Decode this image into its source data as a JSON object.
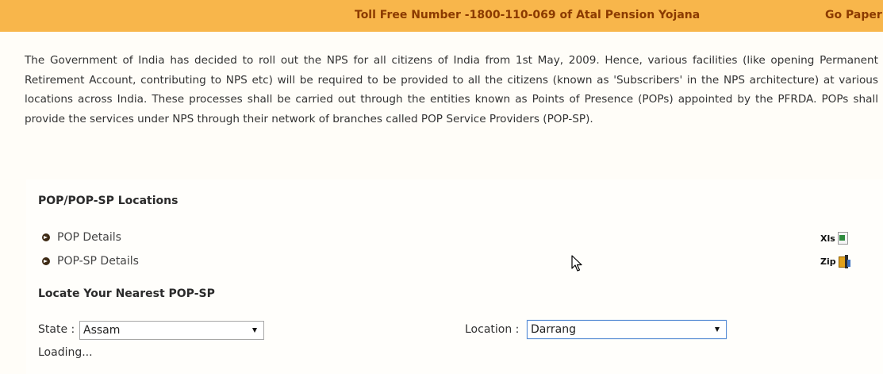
{
  "top_bar": {
    "ticker_1": "Toll Free Number -1800-110-069 of Atal Pension Yojana",
    "ticker_2": "Go Paper"
  },
  "intro": {
    "text": "The Government of India has decided to roll out the NPS for all citizens of India from 1st May, 2009. Hence, various facilities (like opening Permanent Retirement Account, contributing to NPS etc) will be required to be provided to all the citizens (known as 'Subscribers' in the NPS architecture) at various locations across India. These processes shall be carried out through the entities known as Points of Presence (POPs) appointed by the PFRDA. POPs shall provide the services under NPS through their network of branches called POP Service Providers (POP-SP)."
  },
  "locations": {
    "heading": "POP/POP-SP Locations",
    "items": [
      {
        "label": "POP Details",
        "file_label": "Xls",
        "icon": "xls-file-icon"
      },
      {
        "label": "POP-SP Details",
        "file_label": "Zip",
        "icon": "zip-file-icon"
      }
    ]
  },
  "locate": {
    "heading": "Locate Your Nearest POP-SP",
    "state_label": "State :",
    "state_value": "Assam",
    "location_label": "Location :",
    "location_value": "Darrang",
    "status": "Loading..."
  },
  "colors": {
    "top_bar_bg": "#f8b64b",
    "ticker_text": "#8b3a00",
    "focus_border": "#5b8fd6"
  }
}
